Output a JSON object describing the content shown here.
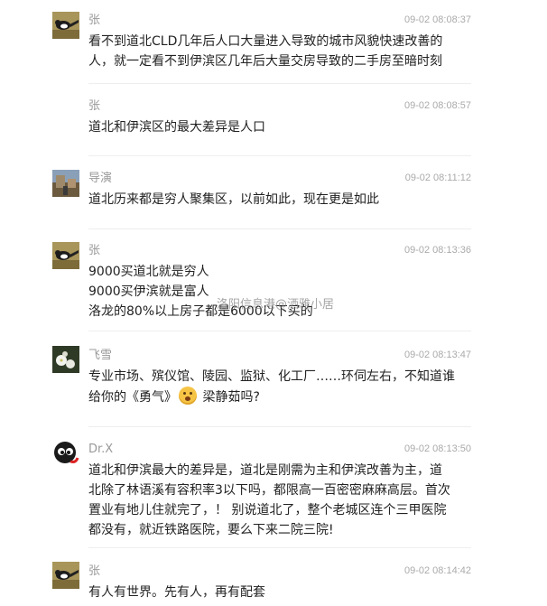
{
  "comments": [
    {
      "name": "张",
      "time": "09-02 08:08:37",
      "content": "看不到道北CLD几年后人口大量进入导致的城市风貌快速改善的\n人，就一定看不到伊滨区几年后大量交房导致的二手房至暗时刻",
      "avatar": "magpie-avatar"
    },
    {
      "name": "张",
      "time": "09-02 08:08:57",
      "content": "道北和伊滨区的最大差异是人口",
      "avatar": "magpie-avatar"
    },
    {
      "name": "导演",
      "time": "09-02 08:11:12",
      "content": "道北历来都是穷人聚集区，以前如此，现在更是如此",
      "avatar": "landscape-avatar"
    },
    {
      "name": "张",
      "time": "09-02 08:13:36",
      "content": "9000买道北就是穷人\n9000买伊滨就是富人\n洛龙的80%以上房子都是6000以下买的",
      "avatar": "magpie-avatar"
    },
    {
      "name": "飞雪",
      "time": "09-02 08:13:47",
      "content_before": "专业市场、殡仪馆、陵园、监狱、化工厂……环伺左右，不知道谁\n给你的《勇气》",
      "content_after": " 梁静茹吗?",
      "avatar": "flower-avatar"
    },
    {
      "name": "Dr.X",
      "time": "09-02 08:13:50",
      "content": "道北和伊滨最大的差异是，道北是刚需为主和伊滨改善为主，道\n北除了林语溪有容积率3以下吗，都限高一百密密麻麻高层。首次\n置业有地儿住就完了，！ 别说道北了，整个老城区连个三甲医院\n都没有，就近铁路医院，要么下来二院三院!",
      "avatar": "cartoon-avatar"
    },
    {
      "name": "张",
      "time": "09-02 08:14:42",
      "content": "有人有世界。先有人，再有配套",
      "avatar": "magpie-avatar"
    }
  ],
  "watermark": "洛阳信息港@洒雅小居",
  "emoji_icon": "grinning-face-emoji"
}
